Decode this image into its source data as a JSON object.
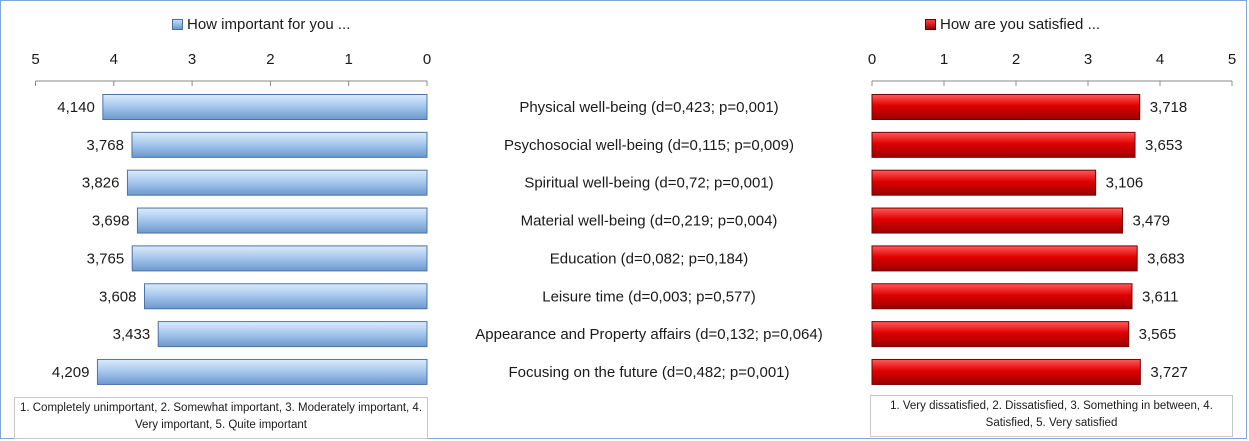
{
  "legend": {
    "importance_label": "How important for you ...",
    "satisfaction_label": "How are you satisfied ..."
  },
  "notes": {
    "importance_scale": "1. Completely unimportant, 2. Somewhat important, 3. Moderately important, 4. Very important, 5. Quite important",
    "satisfaction_scale": "1. Very dissatisfied, 2. Dissatisfied, 3. Something in between, 4. Satisfied, 5. Very satisfied"
  },
  "colors": {
    "importance_bar": "#9ec1ea",
    "satisfaction_bar": "#e00000"
  },
  "chart_data": [
    {
      "type": "bar",
      "orientation": "horizontal",
      "x_axis_reversed": true,
      "series": [
        {
          "name": "How important for you ...",
          "values": [
            4.14,
            3.768,
            3.826,
            3.698,
            3.765,
            3.608,
            3.433,
            4.209
          ]
        }
      ],
      "value_labels": [
        "4,140",
        "3,768",
        "3,826",
        "3,698",
        "3,765",
        "3,608",
        "3,433",
        "4,209"
      ],
      "xlim": [
        0,
        5
      ],
      "ticks": [
        "5",
        "4",
        "3",
        "2",
        "1",
        "0"
      ],
      "legend_position": "top"
    },
    {
      "type": "bar",
      "orientation": "horizontal",
      "series": [
        {
          "name": "How are you satisfied ...",
          "values": [
            3.718,
            3.653,
            3.106,
            3.479,
            3.683,
            3.611,
            3.565,
            3.727
          ]
        }
      ],
      "value_labels": [
        "3,718",
        "3,653",
        "3,106",
        "3,479",
        "3,683",
        "3,611",
        "3,565",
        "3,727"
      ],
      "xlim": [
        0,
        5
      ],
      "ticks": [
        "0",
        "1",
        "2",
        "3",
        "4",
        "5"
      ],
      "legend_position": "top"
    }
  ],
  "categories": [
    "Physical well-being (d=0,423; p=0,001)",
    "Psychosocial well-being (d=0,115; p=0,009)",
    "Spiritual well-being (d=0,72; p=0,001)",
    "Material well-being (d=0,219; p=0,004)",
    "Education (d=0,082; p=0,184)",
    "Leisure time (d=0,003; p=0,577)",
    "Appearance and Property affairs (d=0,132; p=0,064)",
    "Focusing on the future (d=0,482; p=0,001)"
  ]
}
